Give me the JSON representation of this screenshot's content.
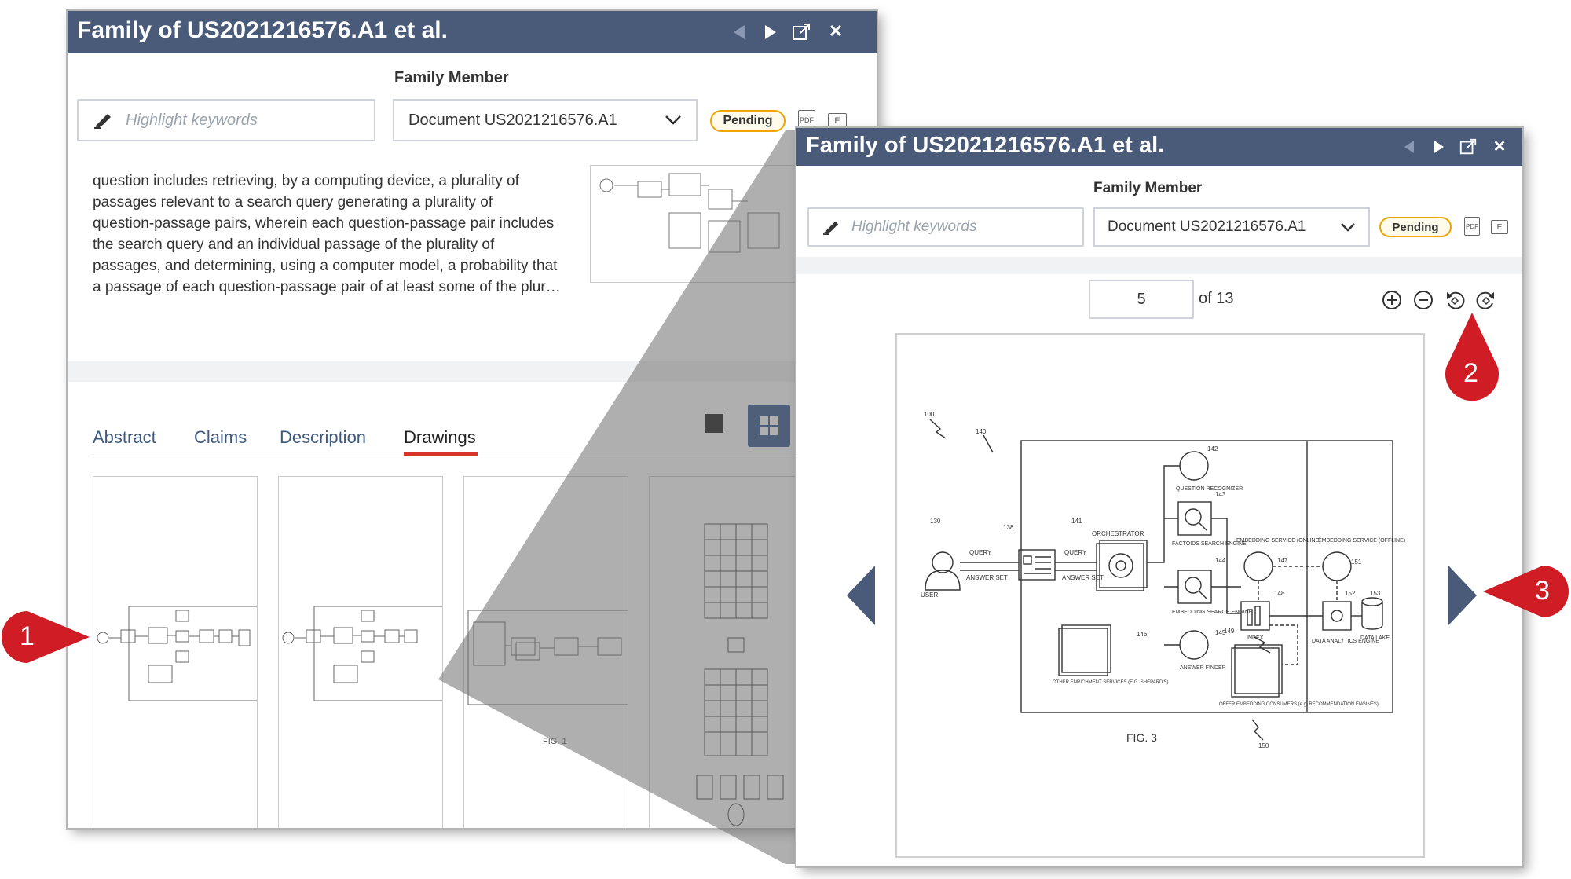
{
  "left_panel": {
    "title": "Family of US2021216576.A1 et al.",
    "family_member_label": "Family Member",
    "highlight_placeholder": "Highlight keywords",
    "document_select": "Document US2021216576.A1",
    "status_badge": "Pending",
    "e_icon": "E",
    "abstract_lines": [
      "question includes retrieving, by a computing device, a plurality of",
      "passages relevant to a search query generating a plurality of",
      "question-passage pairs, wherein each question-passage pair includes",
      "the search query and an individual passage of the plurality of",
      "passages, and determining, using a computer model, a probability that",
      "a passage of each question-passage pair of at least some of the plur…"
    ],
    "tabs": [
      "Abstract",
      "Claims",
      "Description",
      "Drawings"
    ],
    "active_tab": "Drawings",
    "fig_caption": "FIG. 1"
  },
  "right_panel": {
    "title": "Family of US2021216576.A1 et al.",
    "family_member_label": "Family Member",
    "highlight_placeholder": "Highlight keywords",
    "document_select": "Document US2021216576.A1",
    "status_badge": "Pending",
    "e_icon": "E",
    "page_input": "5",
    "page_total": "of 13",
    "zoom_in_icon": "zoom-in-icon",
    "zoom_out_icon": "zoom-out-icon",
    "rotate_left_icon": "rotate-left-icon",
    "rotate_right_icon": "rotate-right-icon",
    "drawing": {
      "caption": "FIG. 3",
      "labels": {
        "user": "USER",
        "query1": "QUERY",
        "answer_set1": "ANSWER SET",
        "query2": "QUERY",
        "answer_set2": "ANSWER SET",
        "orchestrator": "ORCHESTRATOR",
        "question_recognizer": "QUESTION RECOGNIZER",
        "factoids": "FACTOIDS SEARCH ENGINE",
        "embedding_search": "EMBEDDING SEARCH ENGINE",
        "answer_finder": "ANSWER FINDER",
        "other_enrichment": "OTHER ENRICHMENT SERVICES (E.G. SHEPARD'S)",
        "embedding_online": "EMBEDDING SERVICE (ONLINE)",
        "index": "INDEX",
        "offer_embedding": "OFFER EMBEDDING CONSUMERS (e.g. RECOMMENDATION ENGINES)",
        "embedding_offline": "EMBEDDING SERVICE (OFFLINE)",
        "data_analytics": "DATA ANALYTICS ENGINE",
        "data_lake": "DATA LAKE"
      },
      "refs": [
        "100",
        "140",
        "130",
        "138",
        "141",
        "142",
        "143",
        "144",
        "145",
        "146",
        "147",
        "148",
        "149",
        "150",
        "151",
        "152",
        "153"
      ]
    }
  },
  "markers": [
    "1",
    "2",
    "3"
  ],
  "colors": {
    "titlebar": "#4a5b7a",
    "marker_red": "#d01c24",
    "tab_underline": "#d9342b",
    "pending_border": "#f0a500",
    "grid_button": "#2b4f8a"
  }
}
